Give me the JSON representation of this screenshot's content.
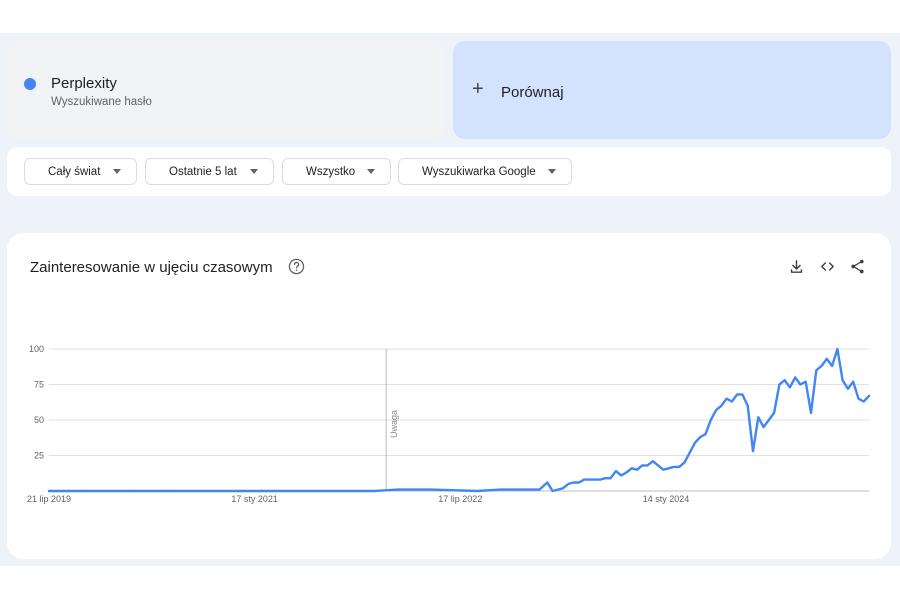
{
  "term": {
    "name": "Perplexity",
    "subtitle": "Wyszukiwane hasło",
    "color": "#4285f4"
  },
  "compare": {
    "plus": "+",
    "label": "Porównaj"
  },
  "filters": [
    {
      "label": "Cały świat"
    },
    {
      "label": "Ostatnie 5 lat"
    },
    {
      "label": "Wszystko"
    },
    {
      "label": "Wyszukiwarka Google"
    }
  ],
  "chart": {
    "title": "Zainteresowanie w ujęciu czasowym",
    "help_icon": "help-circle-icon",
    "actions": [
      "download-icon",
      "embed-code-icon",
      "share-icon"
    ],
    "note_label": "Uwaga"
  },
  "chart_data": {
    "type": "line",
    "ylim": [
      0,
      100
    ],
    "y_ticks": [
      "100",
      "75",
      "50",
      "25"
    ],
    "x_tick_labels": [
      "21 lip 2019",
      "17 sty 2021",
      "17 lip 2022",
      "14 sty 2024"
    ],
    "grid": true,
    "series_color": "#4285f4",
    "x": [
      "2019-07-21",
      "2019-11-01",
      "2020-03-01",
      "2020-06-01",
      "2020-12-01",
      "2021-06-01",
      "2021-12-01",
      "2022-02-01",
      "2022-05-01",
      "2022-09-01",
      "2022-11-01",
      "2022-11-15",
      "2022-12-04",
      "2022-12-18",
      "2023-01-08",
      "2023-01-29",
      "2023-02-12",
      "2023-03-05",
      "2023-03-19",
      "2023-04-02",
      "2023-04-16",
      "2023-04-30",
      "2023-05-14",
      "2023-05-28",
      "2023-06-11",
      "2023-06-25",
      "2023-07-09",
      "2023-07-23",
      "2023-08-06",
      "2023-08-20",
      "2023-09-03",
      "2023-09-17",
      "2023-10-01",
      "2023-10-15",
      "2023-10-29",
      "2023-11-12",
      "2023-11-26",
      "2023-12-10",
      "2023-12-24",
      "2024-01-07",
      "2024-01-21",
      "2024-02-04",
      "2024-02-18",
      "2024-03-03",
      "2024-03-17",
      "2024-03-31",
      "2024-04-14",
      "2024-04-28",
      "2024-05-12",
      "2024-05-26",
      "2024-06-09",
      "2024-06-23",
      "2024-07-07",
      "2024-07-21",
      "2024-08-04",
      "2024-08-18",
      "2024-09-01",
      "2024-09-15",
      "2024-09-29",
      "2024-10-13",
      "2024-10-27",
      "2024-11-10",
      "2024-11-24",
      "2024-12-08",
      "2024-12-22",
      "2025-01-05",
      "2025-01-19",
      "2025-02-02",
      "2025-02-16",
      "2025-03-02",
      "2025-03-16",
      "2025-03-30",
      "2025-04-13",
      "2025-04-27",
      "2025-05-11",
      "2025-05-25",
      "2025-06-08",
      "2025-06-22",
      "2025-07-06"
    ],
    "series": [
      {
        "values": [
          0,
          0,
          0,
          0,
          0,
          0,
          0,
          1,
          1,
          0,
          1,
          1,
          1,
          1,
          1,
          1,
          1,
          6,
          0,
          1,
          2,
          5,
          6,
          6,
          8,
          8,
          8,
          8,
          9,
          9,
          14,
          11,
          13,
          16,
          15,
          18,
          18,
          21,
          18,
          15,
          16,
          17,
          17,
          20,
          27,
          34,
          38,
          40,
          50,
          57,
          60,
          65,
          63,
          68,
          68,
          60,
          28,
          52,
          45,
          50,
          55,
          75,
          78,
          73,
          80,
          75,
          77,
          55,
          85,
          88,
          93,
          88,
          100,
          78,
          72,
          77,
          65,
          63,
          67
        ]
      }
    ]
  }
}
